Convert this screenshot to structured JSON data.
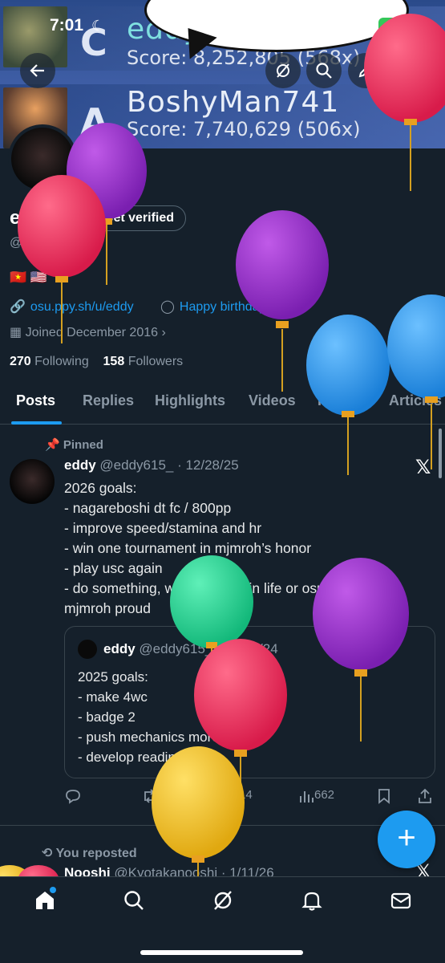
{
  "status_bar": {
    "time": "7:01",
    "battery": "100"
  },
  "banner": {
    "rows": [
      {
        "rank": "C",
        "player": "eddy",
        "score": "Score: 8,252,805 (568x)"
      },
      {
        "rank": "A",
        "player": "BoshyMan741",
        "score": "Score: 7,740,629 (506x)"
      }
    ]
  },
  "profile": {
    "name": "eddy",
    "verify_label": "Get verified",
    "handle": "@eddy615_",
    "flags": "🇻🇳 🇺🇸",
    "link": "osu.ppy.sh/u/eddy",
    "birthday": "Happy birthday!",
    "joined": "Joined December 2016",
    "following_count": "270",
    "following_label": "Following",
    "followers_count": "158",
    "followers_label": "Followers"
  },
  "tabs": [
    "Posts",
    "Replies",
    "Highlights",
    "Videos",
    "Photos",
    "Articles"
  ],
  "pinned_post": {
    "pinned_label": "Pinned",
    "author": "eddy",
    "meta": "@eddy615_ · 12/28/25",
    "lines": [
      "2026 goals:",
      "- nagareboshi dt fc / 800pp",
      "- improve speed/stamina and hr",
      "- win one tournament in mjmroh’s honor",
      "- play usc again",
      "- do something, whether it be in life or osu to make",
      "mjmroh proud"
    ],
    "quote": {
      "author": "eddy",
      "meta": "@eddy615_ · 12/17/24",
      "lines": [
        "2025 goals:",
        "- make 4wc",
        "- badge 2",
        "- push mechanics more",
        "- develop reading..."
      ]
    },
    "actions": {
      "reposts": "1",
      "likes": "14",
      "views": "662"
    }
  },
  "next_post": {
    "repost_label": "You reposted",
    "author": "Nooshi",
    "meta": "@Kyotakanooshi · 1/11/26"
  },
  "colors": {
    "accent": "#1d9bf0",
    "background": "#15202b"
  },
  "nav": [
    "home-icon",
    "search-icon",
    "grok-icon",
    "bell-icon",
    "mail-icon"
  ]
}
